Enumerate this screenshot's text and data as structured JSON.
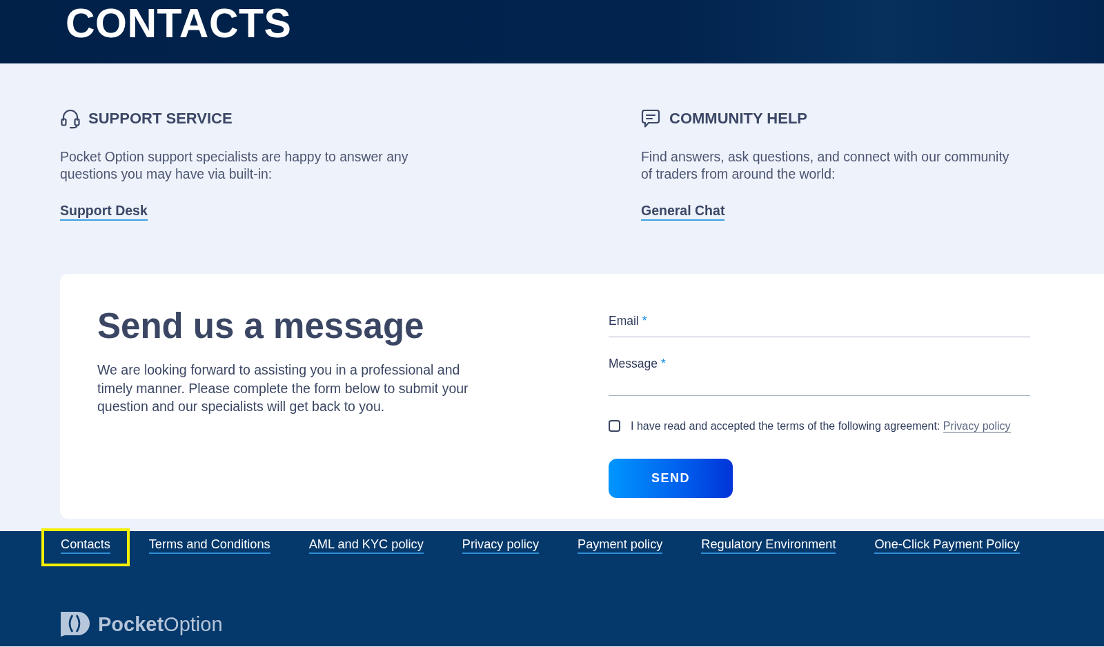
{
  "header": {
    "title": "CONTACTS"
  },
  "help_sections": [
    {
      "kind": "support",
      "title": "SUPPORT SERVICE",
      "text": "Pocket Option support specialists are happy to answer any questions you may have via built-in:",
      "link": "Support Desk"
    },
    {
      "kind": "community",
      "title": "COMMUNITY HELP",
      "text": "Find answers, ask questions, and connect with our community of traders from around the world:",
      "link": "General Chat"
    }
  ],
  "message_card": {
    "title": "Send us a message",
    "text": "We are looking forward to assisting you in a professional and timely manner. Please complete the form below to submit your question and our specialists will get back to you.",
    "form": {
      "fields": [
        {
          "kind": "single_line",
          "label": "Email",
          "required_mark": "*"
        },
        {
          "kind": "multi_line",
          "label": "Message",
          "required_mark": "*"
        }
      ],
      "agreement": {
        "checked": false,
        "text": "I have read and accepted the terms of the following agreement:",
        "link": "Privacy policy"
      },
      "submit": "SEND"
    }
  },
  "footer": {
    "links": [
      {
        "label": "Contacts",
        "highlighted": true
      },
      {
        "label": "Terms and Conditions",
        "highlighted": false
      },
      {
        "label": "AML and KYC policy",
        "highlighted": false
      },
      {
        "label": "Privacy policy",
        "highlighted": false
      },
      {
        "label": "Payment policy",
        "highlighted": false
      },
      {
        "label": "Regulatory Environment",
        "highlighted": false
      },
      {
        "label": "One-Click Payment Policy",
        "highlighted": false
      }
    ],
    "logo": "**Pocket**Option"
  }
}
